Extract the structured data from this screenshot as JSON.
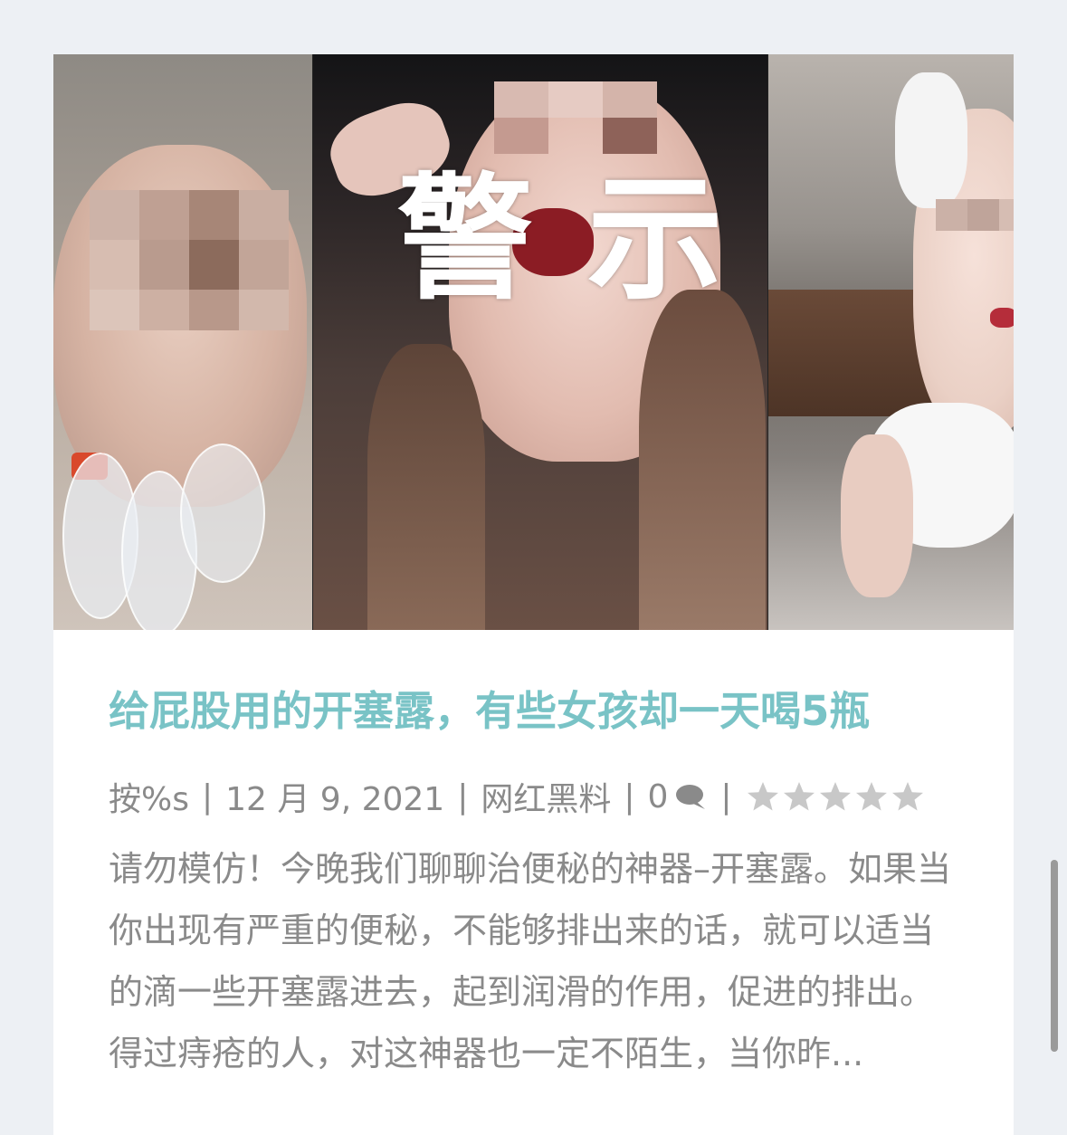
{
  "post": {
    "image": {
      "overlay_text": "警示"
    },
    "title": "给屁股用的开塞露，有些女孩却一天喝5瓶",
    "meta": {
      "author": "按%s",
      "separator": "|",
      "date": "12 月 9, 2021",
      "category": "网红黑料",
      "comment_count": "0",
      "comment_icon": "comment-bubble-icon",
      "rating_stars": 5,
      "rating_filled": 0
    },
    "excerpt": "请勿模仿！今晚我们聊聊治便秘的神器–开塞露。如果当你出现有严重的便秘，不能够排出来的话，就可以适当的滴一些开塞露进去，起到润滑的作用，促进的排出。得过痔疮的人，对这神器也一定不陌生，当你昨..."
  },
  "colors": {
    "background": "#edf0f4",
    "title": "#79c3c6",
    "meta_text": "#8a8a8a",
    "star_fill": "#c8c8c8"
  }
}
